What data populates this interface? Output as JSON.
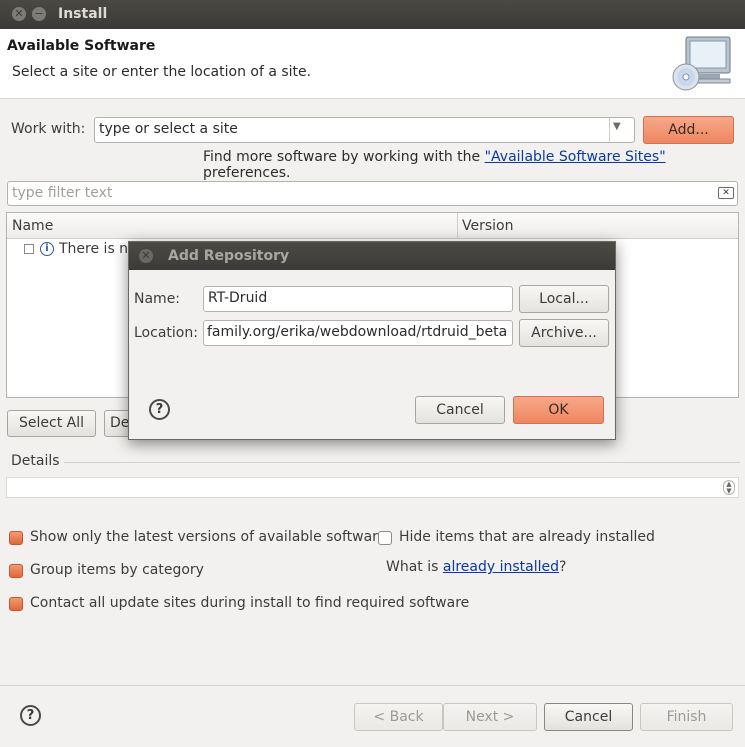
{
  "window": {
    "title": "Install"
  },
  "header": {
    "title": "Available Software",
    "subtitle": "Select a site or enter the location of a site."
  },
  "work_with": {
    "label": "Work with:",
    "value": "type or select a site",
    "add_label": "Add...",
    "find_more_prefix": "Find more software by working with the ",
    "find_more_link": "\"Available Software Sites\"",
    "find_more_suffix": " preferences."
  },
  "filter": {
    "placeholder": "type filter text"
  },
  "table": {
    "columns": [
      "Name",
      "Version"
    ],
    "rows": [
      {
        "name": "There is no"
      }
    ]
  },
  "list_buttons": {
    "select_all": "Select All",
    "deselect_partial": "De"
  },
  "details": {
    "label": "Details"
  },
  "options": {
    "show_latest": "Show only the latest versions of available software",
    "hide_installed": "Hide items that are already installed",
    "group_by_category": "Group items by category",
    "what_is_prefix": "What is ",
    "what_is_link": "already installed",
    "what_is_suffix": "?",
    "contact_sites": "Contact all update sites during install to find required software"
  },
  "footer": {
    "back": "< Back",
    "next": "Next >",
    "cancel": "Cancel",
    "finish": "Finish"
  },
  "dialog": {
    "title": "Add Repository",
    "name_label": "Name:",
    "name_value": "RT-Druid",
    "local_button": "Local...",
    "location_label": "Location:",
    "location_value": "family.org/erika/webdownload/rtdruid_beta",
    "archive_button": "Archive...",
    "cancel": "Cancel",
    "ok": "OK"
  },
  "colors": {
    "accent": "#ef8660",
    "titlebar": "#3b3a36",
    "link": "#0a3aa0"
  }
}
